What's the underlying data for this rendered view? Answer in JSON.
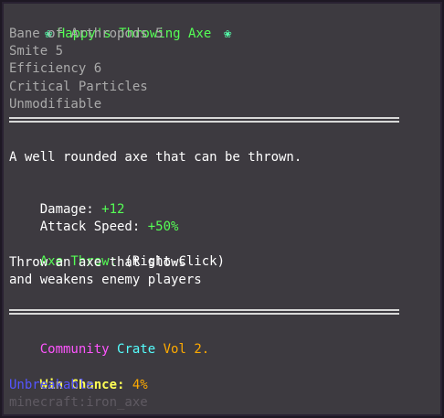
{
  "item": {
    "name": "Happy's Throwing Axe",
    "icon_left": "flower-icon",
    "icon_right": "flower-icon",
    "enchantments": [
      "Bane of Arthropods 5",
      "Smite 5",
      "Efficiency 6",
      "Critical Particles",
      "Unmodifiable"
    ],
    "description": "A well rounded axe that can be thrown.",
    "stats": [
      {
        "label": "Damage: ",
        "value": "+12"
      },
      {
        "label": "Attack Speed: ",
        "value": "+50%"
      }
    ],
    "ability": {
      "name": "Axe Throw:",
      "trigger": " (Right-Click)",
      "lines": [
        "Throw an axe that slows",
        "and weakens enemy players"
      ]
    },
    "crate": {
      "word1": "Community",
      "word2": "Crate",
      "word3": "Vol 2."
    },
    "win_chance": {
      "label": "Win Chance:",
      "value": " 4%"
    },
    "unbreakable": "Unbreakable",
    "item_id": "minecraft:iron_axe"
  },
  "colors": {
    "background": "#3d3a40",
    "name": "#55ff55",
    "enchant": "#aaaaaa",
    "stat_value": "#55ff55",
    "pink": "#ff55ff",
    "aqua": "#55ffff",
    "gold": "#ffaa00",
    "yellow": "#ffff55",
    "blue": "#5555ff",
    "dark_gray": "#5f5a62"
  }
}
